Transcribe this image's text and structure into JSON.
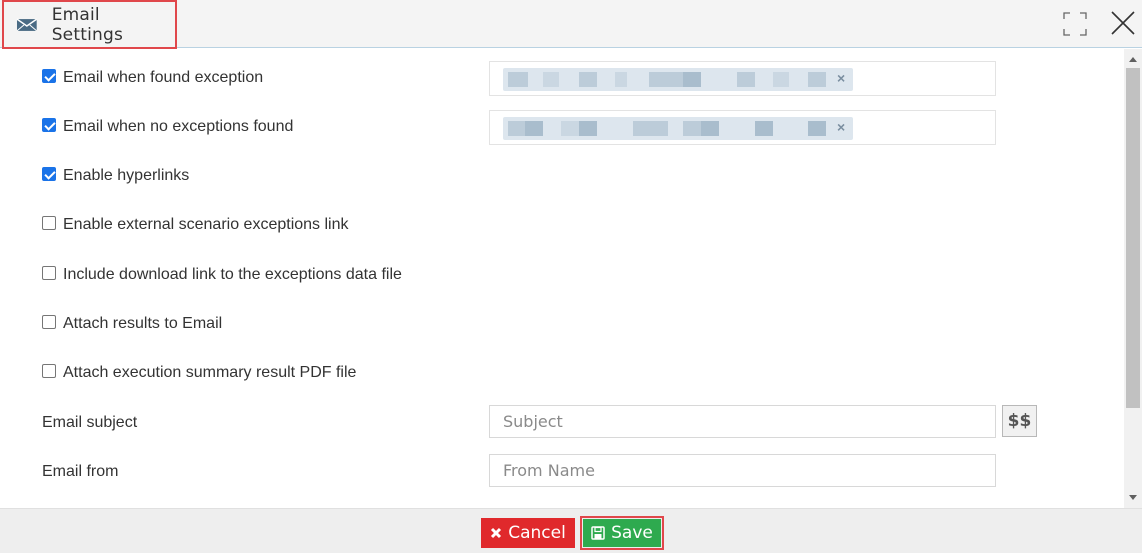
{
  "dialog": {
    "title": "Email Settings",
    "icon": "envelope-icon"
  },
  "window_controls": {
    "maximize_icon": "maximize-icon",
    "close_icon": "close-icon"
  },
  "options": [
    {
      "label": "Email when found exception",
      "checked": true
    },
    {
      "label": "Email when no exceptions found",
      "checked": true
    },
    {
      "label": "Enable hyperlinks",
      "checked": true
    },
    {
      "label": "Enable external scenario exceptions link",
      "checked": false
    },
    {
      "label": "Include download link to the exceptions data file",
      "checked": false
    },
    {
      "label": "Attach results to Email",
      "checked": false
    },
    {
      "label": "Attach execution summary result PDF file",
      "checked": false
    }
  ],
  "recipients": {
    "remove_symbol": "×"
  },
  "fields": {
    "subject_label": "Email subject",
    "subject_placeholder": "Subject",
    "subject_value": "",
    "vars_button": "$$",
    "from_label": "Email from",
    "from_placeholder": "From Name",
    "from_value": ""
  },
  "footer": {
    "cancel_label": "Cancel",
    "save_label": "Save"
  },
  "colors": {
    "cancel": "#e0292c",
    "save": "#2eaa4f",
    "highlight_border": "#e0474b",
    "checkbox_checked": "#1a73e8"
  }
}
